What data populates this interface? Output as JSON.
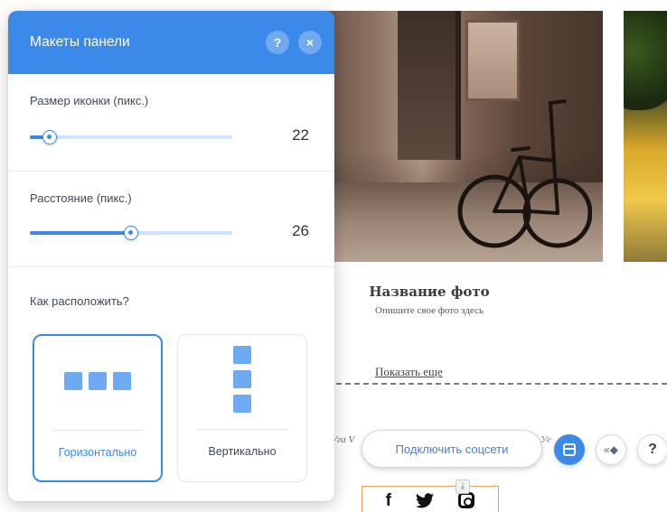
{
  "panel": {
    "title": "Макеты панели",
    "help_symbol": "?",
    "close_symbol": "×",
    "accent_color": "#3b8aea",
    "icon_size": {
      "label": "Размер иконки (пикс.)",
      "value": "22",
      "fraction": 0.1
    },
    "spacing": {
      "label": "Расстояние (пикс.)",
      "value": "26",
      "fraction": 0.5
    },
    "layout": {
      "question": "Как расположить?",
      "options": [
        {
          "label": "Горизонтально",
          "selected": true
        },
        {
          "label": "Вертикально",
          "selected": false
        }
      ]
    }
  },
  "canvas": {
    "photo_title": "Название фото",
    "photo_description": "Опишите свое фото здесь",
    "show_more": "Показать еще",
    "faded_left": "Уга V",
    "faded_right": "Уе",
    "connect_button": "Подключить соцсети",
    "anim_symbol": "«◆",
    "help_symbol": "?",
    "download_symbol": "⤓",
    "social_icons": [
      "facebook-icon",
      "twitter-icon",
      "instagram-icon"
    ],
    "facebook_glyph": "f",
    "twitter_glyph": "🐦"
  }
}
